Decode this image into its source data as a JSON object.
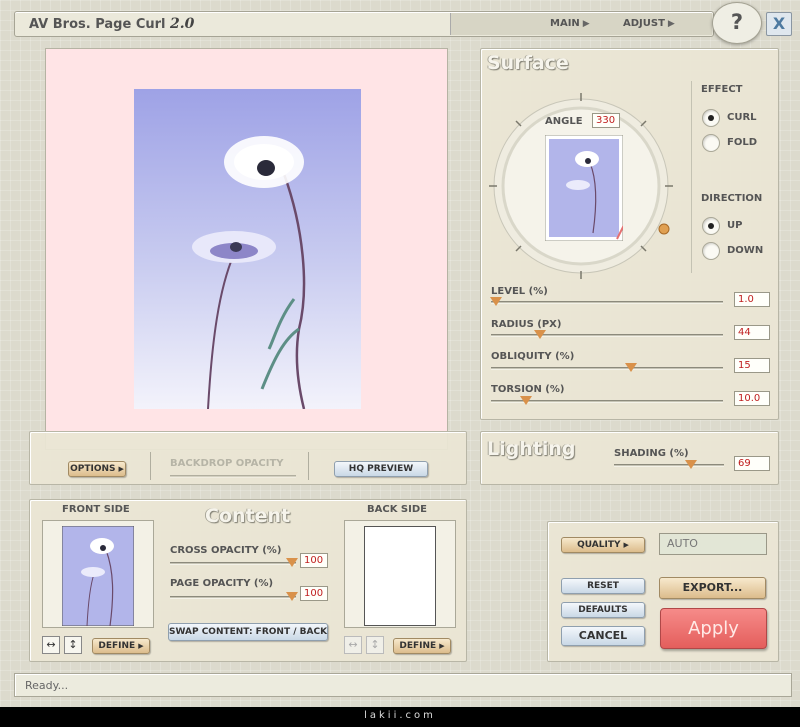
{
  "title": {
    "name": "AV Bros. Page Curl",
    "version": "2.0"
  },
  "nav": {
    "main": "MAIN",
    "adjust": "ADJUST"
  },
  "help_label": "?",
  "close_label": "X",
  "surface": {
    "heading": "Surface",
    "angle_label": "ANGLE",
    "angle_value": "330",
    "effect": {
      "label": "EFFECT",
      "options": [
        "CURL",
        "FOLD"
      ],
      "selected": "CURL"
    },
    "direction": {
      "label": "DIRECTION",
      "options": [
        "UP",
        "DOWN"
      ],
      "selected": "UP"
    },
    "sliders": [
      {
        "label": "LEVEL (%)",
        "value": "1.0"
      },
      {
        "label": "RADIUS (PX)",
        "value": "44"
      },
      {
        "label": "OBLIQUITY (%)",
        "value": "15"
      },
      {
        "label": "TORSION (%)",
        "value": "10.0"
      }
    ]
  },
  "lighting": {
    "heading": "Lighting",
    "shading_label": "SHADING (%)",
    "shading_value": "69"
  },
  "preview_bar": {
    "options_label": "OPTIONS",
    "backdrop_label": "BACKDROP OPACITY",
    "hq_label": "HQ PREVIEW"
  },
  "content": {
    "heading": "Content",
    "front_label": "FRONT SIDE",
    "back_label": "BACK SIDE",
    "cross_label": "CROSS OPACITY (%)",
    "cross_value": "100",
    "page_label": "PAGE OPACITY (%)",
    "page_value": "100",
    "swap_label": "SWAP CONTENT: FRONT / BACK",
    "define_label": "DEFINE"
  },
  "actions": {
    "quality_label": "QUALITY",
    "quality_value": "AUTO",
    "reset": "RESET",
    "defaults": "DEFAULTS",
    "cancel": "CANCEL",
    "export": "EXPORT...",
    "apply": "Apply"
  },
  "status": "Ready...",
  "watermark": "lakii.com",
  "colors": {
    "preview_bg": "#ffe4e6",
    "accent_orange": "#d9914a",
    "apply_red": "#ee6e6c",
    "value_red": "#c02020"
  }
}
